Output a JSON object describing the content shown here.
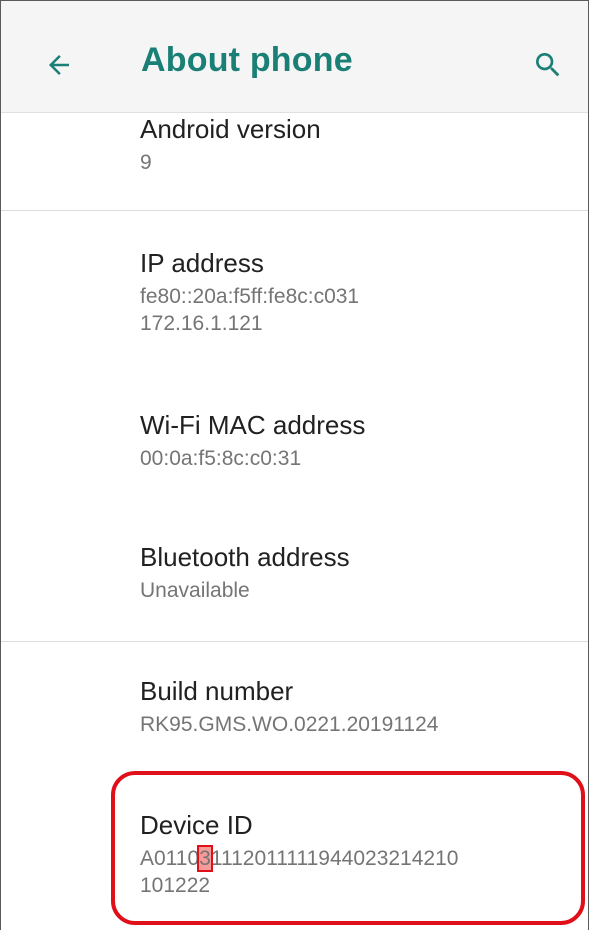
{
  "header": {
    "title": "About phone",
    "back_icon": "arrow-left-icon",
    "search_icon": "search-icon",
    "accent_color": "#1a7f75"
  },
  "items": [
    {
      "label": "Android version",
      "value": "9"
    },
    {
      "label": "IP address",
      "value_lines": [
        "fe80::20a:f5ff:fe8c:c031",
        "172.16.1.121"
      ]
    },
    {
      "label": "Wi-Fi MAC address",
      "value": "00:0a:f5:8c:c0:31"
    },
    {
      "label": "Bluetooth address",
      "value": "Unavailable"
    },
    {
      "label": "Build number",
      "value": "RK95.GMS.WO.0221.20191124"
    },
    {
      "label": "Device ID",
      "value_parts": [
        "A0110",
        "3",
        "1112011111944023214210"
      ],
      "value_line2": "101222"
    }
  ],
  "highlight_color": "#e0101a"
}
